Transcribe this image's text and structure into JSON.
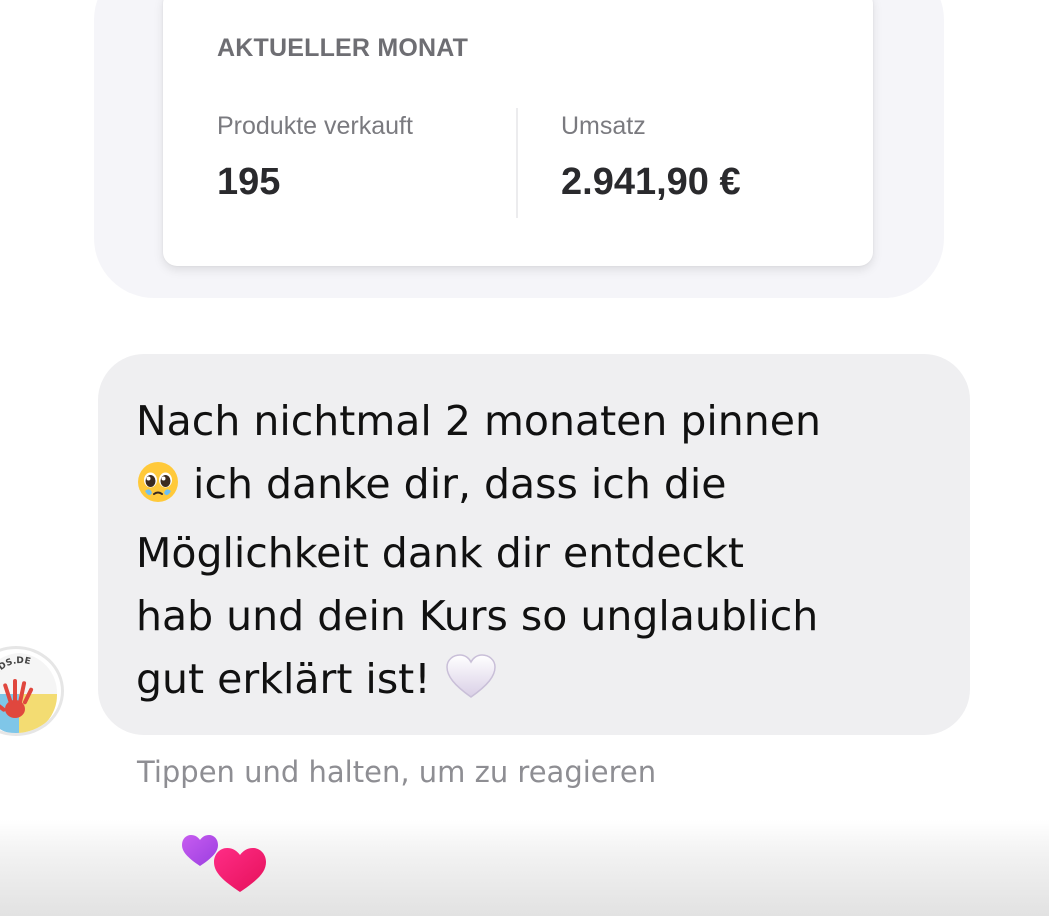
{
  "stats_card": {
    "title": "AKTUELLER MONAT",
    "products_label": "Produkte verkauft",
    "products_value": "195",
    "revenue_label": "Umsatz",
    "revenue_value": "2.941,90 €"
  },
  "message": {
    "line1": "Nach nichtmal 2 monaten pinnen",
    "line2": "ich danke dir, dass ich die",
    "line3": "Möglichkeit dank dir entdeckt",
    "line4": "hab und dein Kurs so unglaublich",
    "line5": "gut erklärt ist!",
    "emoji_1": "pleading-face-icon",
    "emoji_2": "white-heart-icon"
  },
  "hint": "Tippen und halten, um zu reagieren",
  "avatar_logo_text": "INKIDS.DE",
  "reaction_icon": "two-hearts-icon"
}
